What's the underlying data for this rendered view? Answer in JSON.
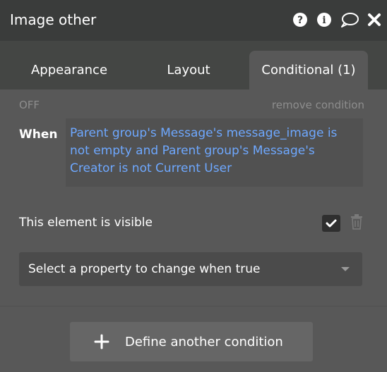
{
  "header": {
    "title": "Image other",
    "icons": [
      "question-circle-icon",
      "info-circle-icon",
      "comment-icon",
      "close-icon"
    ]
  },
  "tabs": [
    {
      "label": "Appearance",
      "active": false
    },
    {
      "label": "Layout",
      "active": false
    },
    {
      "label": "Conditional (1)",
      "active": true
    }
  ],
  "condition": {
    "status": "OFF",
    "remove_label": "remove condition",
    "when_label": "When",
    "expression": "Parent group's Message's message_image is not empty and Parent group's Message's Creator is not Current User"
  },
  "visibility": {
    "label": "This element is visible",
    "checked": true
  },
  "property_select": {
    "placeholder": "Select a property to change when true"
  },
  "define_button": {
    "label": "Define another condition"
  },
  "colors": {
    "header_bg": "#3a3c3b",
    "panel_bg": "#585858",
    "expression_text": "#6ea8ff"
  }
}
